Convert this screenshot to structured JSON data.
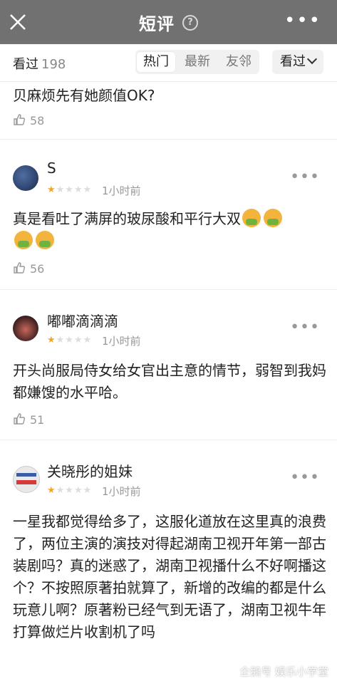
{
  "header": {
    "title": "短评",
    "help_icon": "question-circle-icon",
    "more_label": "•••"
  },
  "tabbar": {
    "seen_label": "看过",
    "seen_count": "198",
    "sort_tabs": [
      "热门",
      "最新",
      "友邻"
    ],
    "filter_label": "看过"
  },
  "reviews": [
    {
      "text": "贝麻烦先有她颜值OK?",
      "likes": "58"
    },
    {
      "user": "S",
      "rating": 1,
      "time": "1小时前",
      "text": "真是看吐了满屏的玻尿酸和平行大双",
      "likes": "56"
    },
    {
      "user": "嘟嘟滴滴滴",
      "rating": 1,
      "time": "1小时前",
      "text": "开头尚服局侍女给女官出主意的情节，弱智到我妈都嫌馊的水平哈。",
      "likes": "51"
    },
    {
      "user": "关晓彤的姐妹",
      "rating": 1,
      "time": "1小时前",
      "text": "一星我都觉得给多了，这服化道放在这里真的浪费了，两位主演的演技对得起湖南卫视开年第一部古装剧吗？真的迷惑了，湖南卫视播什么不好啊播这个？不按照原著拍就算了，新增的改编的都是什么玩意儿啊？原著粉已经气到无语了，湖南卫视牛年打算做烂片收割机了吗"
    }
  ],
  "watermark": "企鹅号 娱乐小学堂"
}
